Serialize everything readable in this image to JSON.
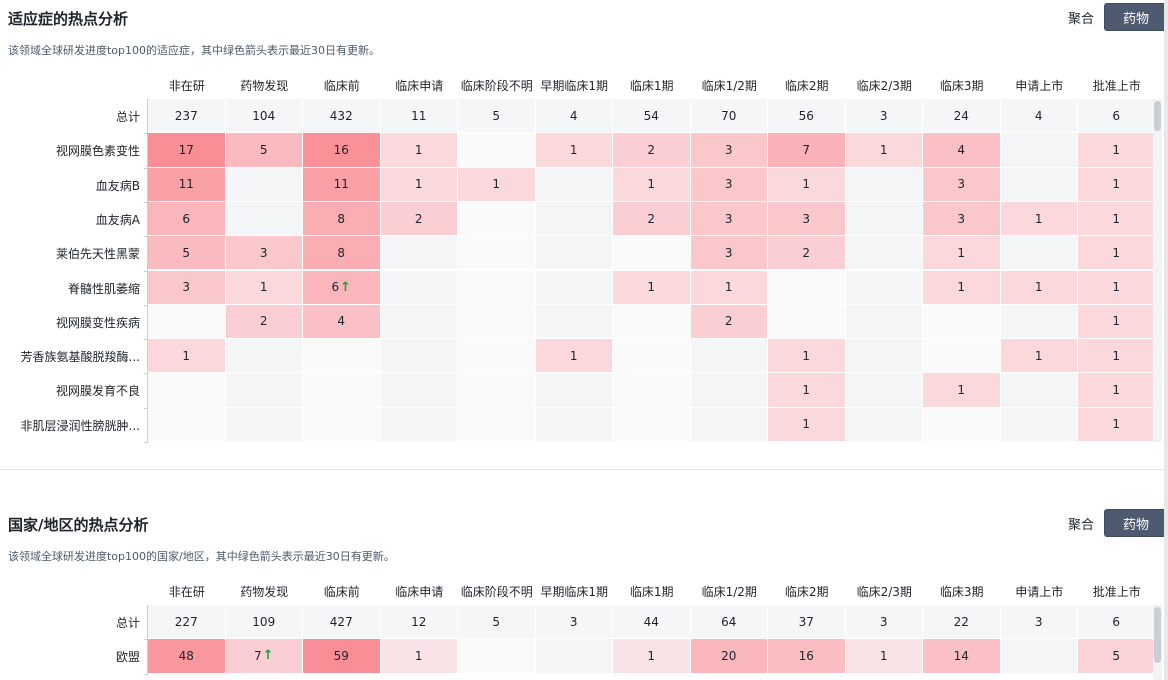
{
  "columns": [
    "非在研",
    "药物发现",
    "临床前",
    "临床申请",
    "临床阶段不明",
    "早期临床1期",
    "临床1期",
    "临床1/2期",
    "临床2期",
    "临床2/3期",
    "临床3期",
    "申请上市",
    "批准上市"
  ],
  "toggle": {
    "option_aggregate": "聚合",
    "option_drug": "药物"
  },
  "colors": {
    "accent": "#4e5a70",
    "arrow": "#1aa33a"
  },
  "section1": {
    "title": "适应症的热点分析",
    "subtitle": "该领域全球研发进度top100的适应症，其中绿色箭头表示最近30日有更新。",
    "rows": [
      {
        "label": "总计",
        "cells": [
          "237",
          "104",
          "432",
          "11",
          "5",
          "4",
          "54",
          "70",
          "56",
          "3",
          "24",
          "4",
          "6"
        ],
        "arrows": []
      },
      {
        "label": "视网膜色素变性",
        "cells": [
          "17",
          "5",
          "16",
          "1",
          "",
          "1",
          "2",
          "3",
          "7",
          "1",
          "4",
          "",
          "1"
        ],
        "arrows": []
      },
      {
        "label": "血友病B",
        "cells": [
          "11",
          "",
          "11",
          "1",
          "1",
          "",
          "1",
          "3",
          "1",
          "",
          "3",
          "",
          "1"
        ],
        "arrows": []
      },
      {
        "label": "血友病A",
        "cells": [
          "6",
          "",
          "8",
          "2",
          "",
          "",
          "2",
          "3",
          "3",
          "",
          "3",
          "1",
          "1"
        ],
        "arrows": []
      },
      {
        "label": "莱伯先天性黑蒙",
        "cells": [
          "5",
          "3",
          "8",
          "",
          "",
          "",
          "",
          "3",
          "2",
          "",
          "1",
          "",
          "1"
        ],
        "arrows": []
      },
      {
        "label": "脊髓性肌萎缩",
        "cells": [
          "3",
          "1",
          "6",
          "",
          "",
          "",
          "1",
          "1",
          "",
          "",
          "1",
          "1",
          "1"
        ],
        "arrows": [
          2
        ]
      },
      {
        "label": "视网膜变性疾病",
        "cells": [
          "",
          "2",
          "4",
          "",
          "",
          "",
          "",
          "2",
          "",
          "",
          "",
          "",
          "1"
        ],
        "arrows": []
      },
      {
        "label": "芳香族氨基酸脱羧酶...",
        "cells": [
          "1",
          "",
          "",
          "",
          "",
          "1",
          "",
          "",
          "1",
          "",
          "",
          "1",
          "1"
        ],
        "arrows": []
      },
      {
        "label": "视网膜发育不良",
        "cells": [
          "",
          "",
          "",
          "",
          "",
          "",
          "",
          "",
          "1",
          "",
          "1",
          "",
          "1"
        ],
        "arrows": []
      },
      {
        "label": "非肌层浸润性膀胱肿...",
        "cells": [
          "",
          "",
          "",
          "",
          "",
          "",
          "",
          "",
          "1",
          "",
          "",
          "",
          "1"
        ],
        "arrows": []
      }
    ]
  },
  "section2": {
    "title": "国家/地区的热点分析",
    "subtitle": "该领域全球研发进度top100的国家/地区，其中绿色箭头表示最近30日有更新。",
    "rows": [
      {
        "label": "总计",
        "cells": [
          "227",
          "109",
          "427",
          "12",
          "5",
          "3",
          "44",
          "64",
          "37",
          "3",
          "22",
          "3",
          "6"
        ],
        "arrows": []
      },
      {
        "label": "欧盟",
        "cells": [
          "48",
          "7",
          "59",
          "1",
          "",
          "",
          "1",
          "20",
          "16",
          "1",
          "14",
          "",
          "5"
        ],
        "arrows": [
          1
        ]
      }
    ]
  }
}
